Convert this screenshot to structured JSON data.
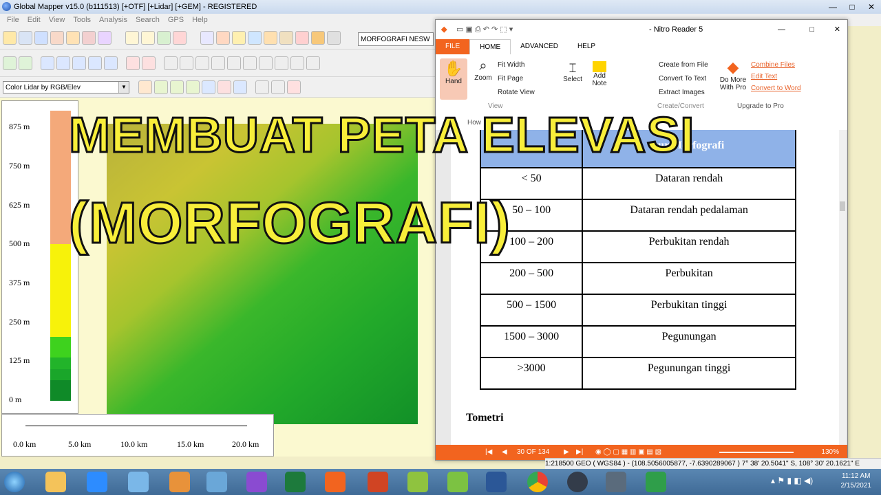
{
  "app": {
    "title": "Global Mapper v15.0 (b111513) [+OTF] [+Lidar] [+GEM] - REGISTERED",
    "menu": [
      "File",
      "Edit",
      "View",
      "Tools",
      "Analysis",
      "Search",
      "GPS",
      "Help"
    ],
    "window_controls": [
      "—",
      "□",
      "✕"
    ],
    "search_value": "MORFOGRAFI NESW",
    "layer_select": "Color Lidar by RGB/Elev"
  },
  "legend": {
    "labels": [
      "875 m",
      "750 m",
      "625 m",
      "500 m",
      "375 m",
      "250 m",
      "125 m",
      "0 m"
    ]
  },
  "scale_bar": {
    "labels": [
      "0.0 km",
      "5.0 km",
      "10.0 km",
      "15.0 km",
      "20.0 km"
    ]
  },
  "nitro": {
    "title": "- Nitro Reader 5",
    "tabs": [
      "FILE",
      "HOME",
      "ADVANCED",
      "HELP"
    ],
    "ribbon": {
      "hand": "Hand",
      "zoom": "Zoom",
      "fit_width": "Fit Width",
      "fit_page": "Fit Page",
      "rotate_view": "Rotate View",
      "view_group": "View",
      "select": "Select",
      "add_note": "Add Note",
      "create_from_file": "Create from File",
      "convert_to_text": "Convert To Text",
      "extract_images": "Extract Images",
      "create_convert_group": "Create/Convert",
      "do_more": "Do More With Pro",
      "combine_files": "Combine Files",
      "edit_text": "Edit Text",
      "convert_to_word": "Convert to Word",
      "upgrade_group": "Upgrade to Pro",
      "how": "How"
    },
    "table_header_right": "sur Morfografi",
    "table_rows": [
      [
        "< 50",
        "Dataran rendah"
      ],
      [
        "50 – 100",
        "Dataran rendah pedalaman"
      ],
      [
        "100 – 200",
        "Perbukitan rendah"
      ],
      [
        "200 – 500",
        "Perbukitan"
      ],
      [
        "500 – 1500",
        "Perbukitan tinggi"
      ],
      [
        "1500 – 3000",
        "Pegunungan"
      ],
      [
        ">3000",
        "Pegunungan tinggi"
      ]
    ],
    "foot_text": "Tometri",
    "page_indicator": "30 OF 134",
    "zoom_level": "130%"
  },
  "overlay": {
    "line1": "MEMBUAT PETA ELEVASI",
    "line2": "(MORFOGRAFI)"
  },
  "status": {
    "text": "1:218500  GEO ( WGS84 ) - (108.5056005877, -7.6390289067 )  7° 38' 20.5041\" S, 108° 30' 20.1621\" E"
  },
  "taskbar": {
    "time": "11:12 AM",
    "date": "2/15/2021"
  },
  "colors": {
    "nitro_orange": "#f2641f",
    "title_yellow": "#f8ee3a",
    "table_header": "#8fb2e8"
  }
}
